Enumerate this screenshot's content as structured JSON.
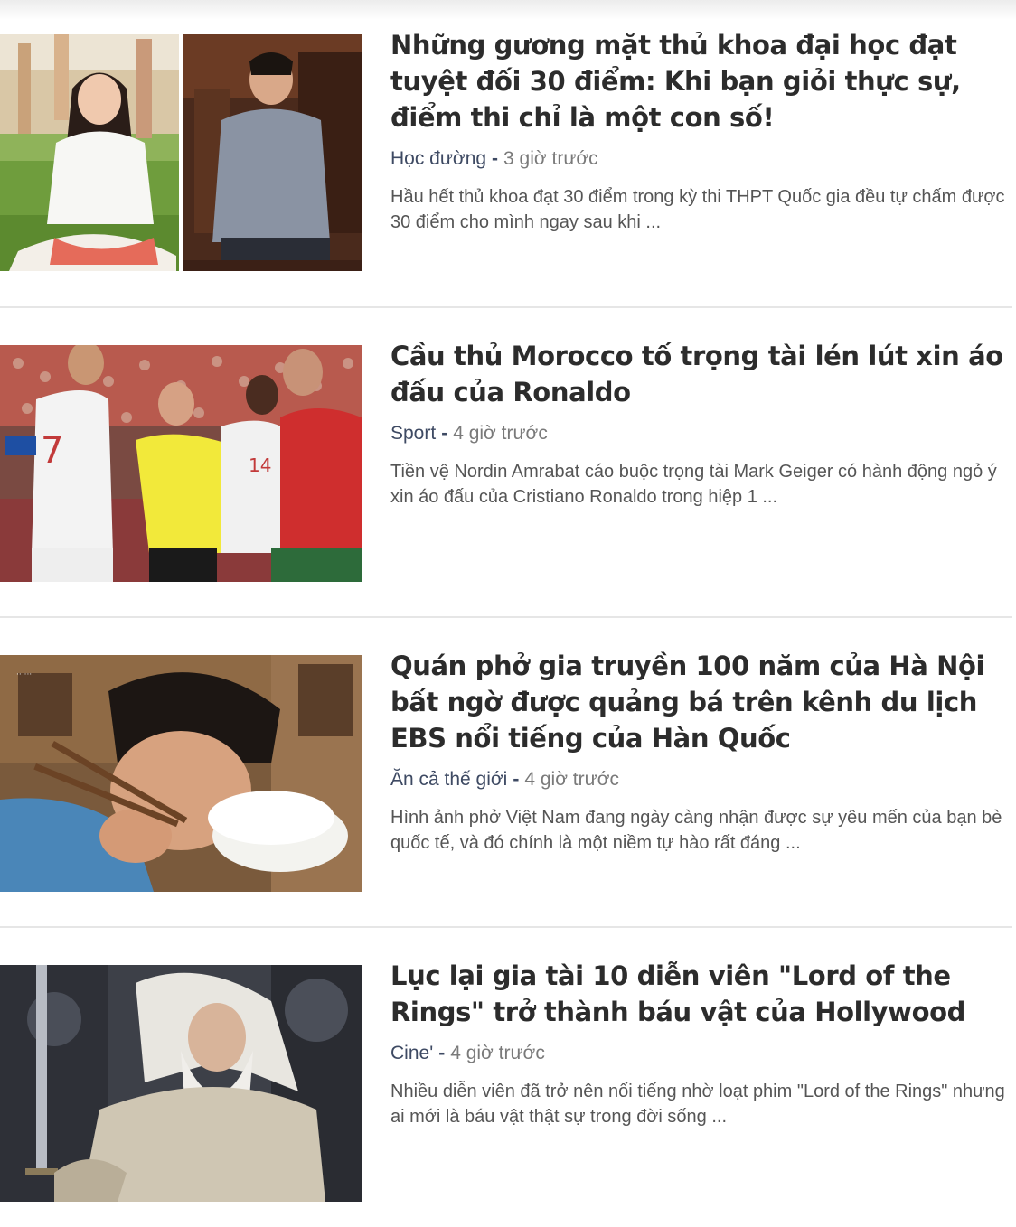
{
  "articles": [
    {
      "title": "Những gương mặt thủ khoa đại học đạt tuyệt đối 30 điểm: Khi bạn giỏi thực sự, điểm thi chỉ là một con số!",
      "category": "Học đường",
      "separator": "-",
      "time": "3 giờ trước",
      "summary": "Hầu hết thủ khoa đạt 30 điểm trong kỳ thi THPT Quốc gia đều tự chấm được 30 điểm cho mình ngay sau khi ...",
      "thumbnail": "photo-two-students"
    },
    {
      "title": "Cầu thủ Morocco tố trọng tài lén lút xin áo đấu của Ronaldo",
      "category": "Sport",
      "separator": "-",
      "time": "4 giờ trước",
      "summary": "Tiền vệ Nordin Amrabat cáo buộc trọng tài Mark Geiger có hành động ngỏ ý xin áo đấu của Cristiano Ronaldo trong hiệp 1 ...",
      "thumbnail": "photo-football-referee"
    },
    {
      "title": "Quán phở gia truyền 100 năm của Hà Nội bất ngờ được quảng bá trên kênh du lịch EBS nổi tiếng của Hàn Quốc",
      "category": "Ăn cả thế giới",
      "separator": "-",
      "time": "4 giờ trước",
      "summary": "Hình ảnh phở Việt Nam đang ngày càng nhận được sự yêu mến của bạn bè quốc tế, và đó chính là một niềm tự hào rất đáng ...",
      "thumbnail": "photo-man-eating-pho"
    },
    {
      "title": "Lục lại gia tài 10 diễn viên \"Lord of the Rings\" trở thành báu vật của Hollywood",
      "category": "Cine'",
      "separator": "-",
      "time": "4 giờ trước",
      "summary": "Nhiều diễn viên đã trở nên nổi tiếng nhờ loạt phim \"Lord of the Rings\" nhưng ai mới là báu vật thật sự trong đời sống ...",
      "thumbnail": "photo-gandalf"
    }
  ],
  "colors": {
    "title": "#2c2c2c",
    "category": "#3e4a63",
    "time": "#7a7a7a",
    "summary": "#555555",
    "divider": "#e6e6e6"
  }
}
